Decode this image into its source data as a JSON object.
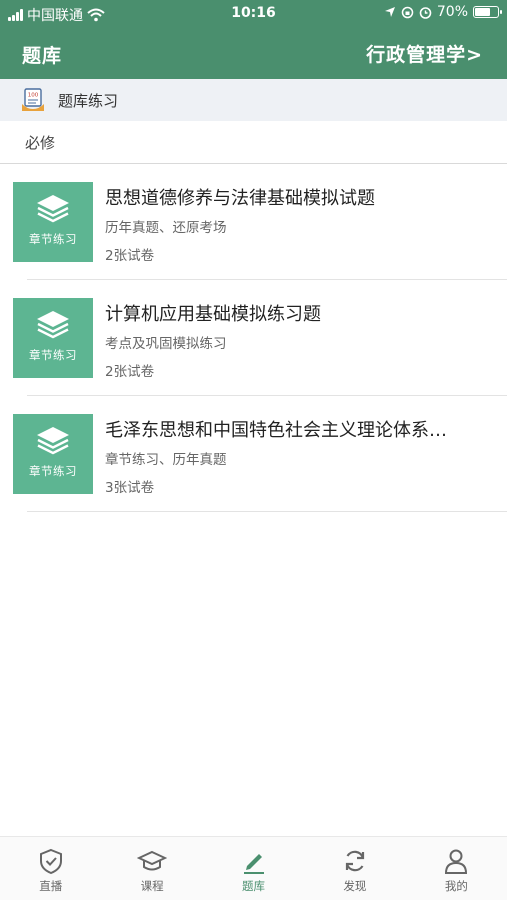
{
  "status_bar": {
    "carrier": "中国联通",
    "time": "10:16",
    "battery": "70%",
    "battery_level": 0.7
  },
  "nav": {
    "title": "题库",
    "subject": "行政管理学>"
  },
  "breadcrumb": {
    "label": "题库练习",
    "icon_text": "100"
  },
  "section": {
    "label": "必修"
  },
  "items": [
    {
      "thumb_label": "章节练习",
      "title": "思想道德修养与法律基础模拟试题",
      "subtitle": "历年真题、还原考场",
      "count": "2张试卷"
    },
    {
      "thumb_label": "章节练习",
      "title": "计算机应用基础模拟练习题",
      "subtitle": "考点及巩固模拟练习",
      "count": "2张试卷"
    },
    {
      "thumb_label": "章节练习",
      "title": "毛泽东思想和中国特色社会主义理论体系…",
      "subtitle": "章节练习、历年真题",
      "count": "3张试卷"
    }
  ],
  "tabs": [
    {
      "label": "直播",
      "icon": "shield-check-icon"
    },
    {
      "label": "课程",
      "icon": "graduation-cap-icon"
    },
    {
      "label": "题库",
      "icon": "pencil-icon",
      "active": true
    },
    {
      "label": "发现",
      "icon": "refresh-icon"
    },
    {
      "label": "我的",
      "icon": "person-icon"
    }
  ],
  "colors": {
    "primary": "#4a8f6e",
    "thumb": "#5db592",
    "breadcrumb_bg": "#eef1f5",
    "inactive_tab": "#666666"
  }
}
